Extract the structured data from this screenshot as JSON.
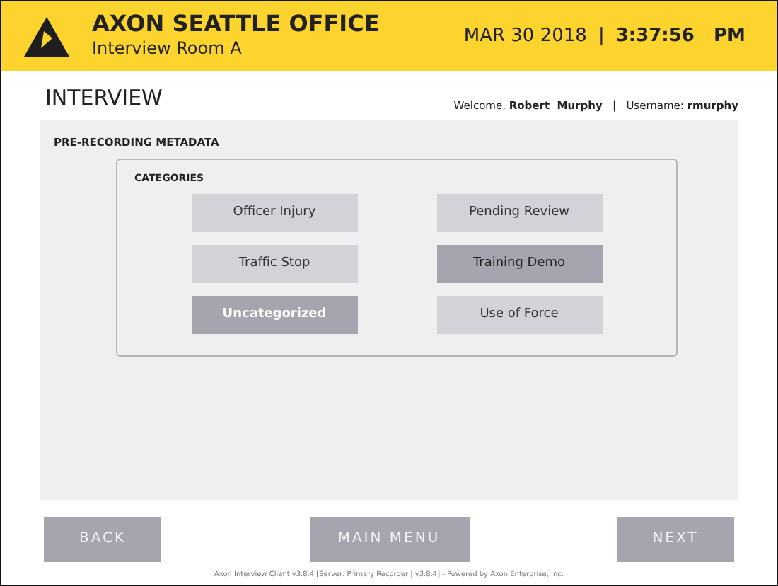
{
  "header": {
    "office": "AXON SEATTLE OFFICE",
    "room": "Interview Room A",
    "date": "MAR 30 2018",
    "separator": "|",
    "time": "3:37:56   PM"
  },
  "page": {
    "title": "INTERVIEW",
    "welcome": "Welcome, **Robert  Murphy**   |   Username: **rmurphy**"
  },
  "panel": {
    "title": "PRE-RECORDING METADATA",
    "group_title": "CATEGORIES",
    "categories": [
      {
        "label": "Officer Injury",
        "selected": false
      },
      {
        "label": "Pending Review",
        "selected": false
      },
      {
        "label": "Traffic Stop",
        "selected": false
      },
      {
        "label": "Training Demo",
        "selected": true
      },
      {
        "label": "Uncategorized",
        "selected": true
      },
      {
        "label": "Use of Force",
        "selected": false
      }
    ]
  },
  "buttons": [
    "BACK",
    "MAIN MENU",
    "NEXT"
  ],
  "footer": "Axon Interview Client v3.8.4 [Server: Primary Recorder | v3.8.4] - Powered by Axon Enterprise, Inc."
}
